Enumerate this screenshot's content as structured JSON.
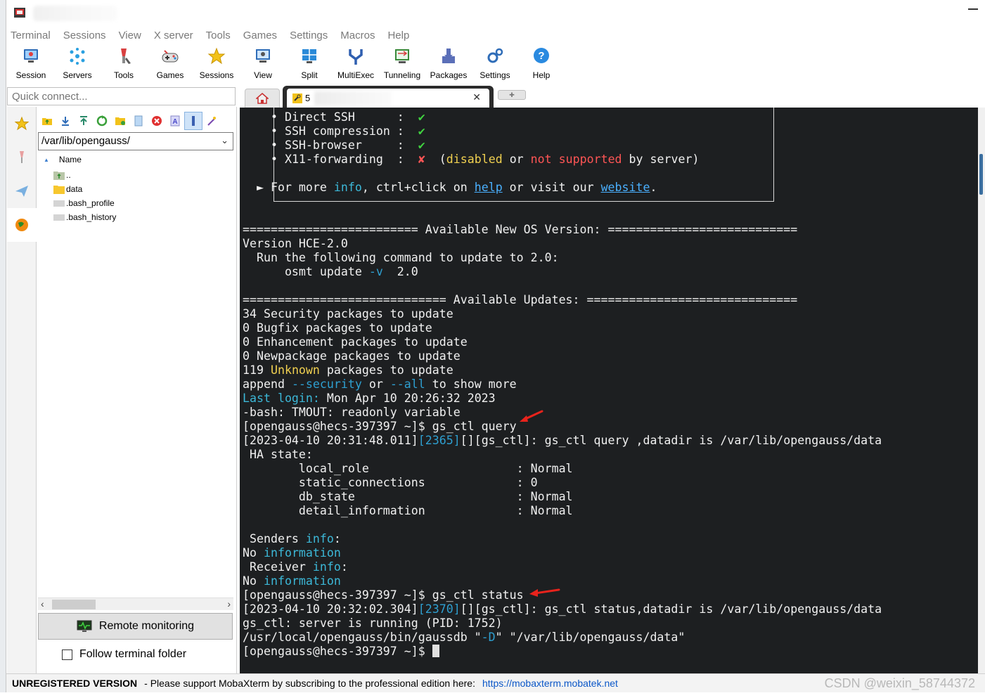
{
  "menu": [
    "Terminal",
    "Sessions",
    "View",
    "X server",
    "Tools",
    "Games",
    "Settings",
    "Macros",
    "Help"
  ],
  "toolbar": [
    {
      "label": "Session",
      "icon": "session-icon"
    },
    {
      "label": "Servers",
      "icon": "servers-icon"
    },
    {
      "label": "Tools",
      "icon": "tools-icon"
    },
    {
      "label": "Games",
      "icon": "games-icon"
    },
    {
      "label": "Sessions",
      "icon": "sessions-star-icon"
    },
    {
      "label": "View",
      "icon": "view-icon"
    },
    {
      "label": "Split",
      "icon": "split-icon"
    },
    {
      "label": "MultiExec",
      "icon": "multiexec-icon"
    },
    {
      "label": "Tunneling",
      "icon": "tunneling-icon"
    },
    {
      "label": "Packages",
      "icon": "packages-icon"
    },
    {
      "label": "Settings",
      "icon": "settings-icon"
    },
    {
      "label": "Help",
      "icon": "help-icon"
    }
  ],
  "quick_connect": {
    "placeholder": "Quick connect..."
  },
  "file_browser": {
    "path": "/var/lib/opengauss/",
    "column_header": "Name",
    "files": [
      {
        "name": "..",
        "type": "parent"
      },
      {
        "name": "data",
        "type": "folder"
      },
      {
        "name": ".bash_profile",
        "type": "file"
      },
      {
        "name": ".bash_history",
        "type": "file"
      }
    ],
    "remote_monitoring": "Remote monitoring",
    "follow_terminal_folder": "Follow terminal folder",
    "follow_checked": false
  },
  "tabs": {
    "session_tab_number": "5"
  },
  "terminal": {
    "features": [
      {
        "name": "Direct SSH",
        "status": "✔"
      },
      {
        "name": "SSH compression",
        "status": "✔"
      },
      {
        "name": "SSH-browser",
        "status": "✔"
      },
      {
        "name": "X11-forwarding",
        "status": "✘"
      }
    ],
    "x11_note_open": "(",
    "x11_note_disabled": "disabled",
    "x11_note_or": " or ",
    "x11_note_not_supported": "not supported",
    "x11_note_close": " by server)",
    "more_info_prefix": "► For more ",
    "more_info_info": "info",
    "more_info_mid": ", ctrl+click on ",
    "more_info_help": "help",
    "more_info_mid2": " or visit our ",
    "more_info_website": "website",
    "more_info_end": ".",
    "os_header": "========================= Available New OS Version: ===========================",
    "os_version": "Version HCE-2.0",
    "os_run": "  Run the following command to update to 2.0:",
    "os_cmd_a": "      osmt update ",
    "os_cmd_flag": "-v",
    "os_cmd_b": "  2.0",
    "updates_header": "============================= Available Updates: ==============================",
    "upd_security": "34 Security packages to update",
    "upd_bugfix": "0 Bugfix packages to update",
    "upd_enh": "0 Enhancement packages to update",
    "upd_new": "0 Newpackage packages to update",
    "upd_unknown_a": "119 ",
    "upd_unknown_word": "Unknown",
    "upd_unknown_b": " packages to update",
    "append_a": "append ",
    "append_security": "--security",
    "append_or": " or ",
    "append_all": "--all",
    "append_b": " to show more",
    "last_login_label": "Last login:",
    "last_login_value": " Mon Apr 10 20:26:32 2023",
    "tmout": "-bash: TMOUT: readonly variable",
    "prompt1": "[opengauss@hecs-397397 ~]$ gs_ctl query",
    "query_a": "[2023-04-10 20:31:48.011]",
    "query_pid": "[2365]",
    "query_b": "[][gs_ctl]: gs_ctl query ,datadir is /var/lib/opengauss/data",
    "ha_state": " HA state:",
    "ha_rows": [
      "        local_role                     : Normal",
      "        static_connections             : 0",
      "        db_state                       : Normal",
      "        detail_information             : Normal"
    ],
    "senders_a": " Senders ",
    "info_word": "info",
    "colon": ":",
    "no_word": "No ",
    "information_word": "information",
    "receiver_a": " Receiver ",
    "prompt2": "[opengauss@hecs-397397 ~]$ gs_ctl status",
    "status_a": "[2023-04-10 20:32:02.304]",
    "status_pid": "[2370]",
    "status_b": "[][gs_ctl]: gs_ctl status,datadir is /var/lib/opengauss/data",
    "running": "gs_ctl: server is running (PID: 1752)",
    "gaussdb_a": "/usr/local/opengauss/bin/gaussdb \"",
    "gaussdb_flag": "-D",
    "gaussdb_b": "\" \"/var/lib/opengauss/data\"",
    "prompt3": "[opengauss@hecs-397397 ~]$ "
  },
  "status_bar": {
    "unregistered": "UNREGISTERED VERSION",
    "message": "-  Please support MobaXterm by subscribing to the professional edition here:",
    "link": "https://mobaxterm.mobatek.net"
  },
  "watermark": "CSDN @weixin_58744372",
  "colors": {
    "terminal_bg": "#1d1f21",
    "accent_red_arrow": "#e8231c",
    "check_green": "#40d240",
    "highlight_cyan": "#3cb8d8"
  }
}
